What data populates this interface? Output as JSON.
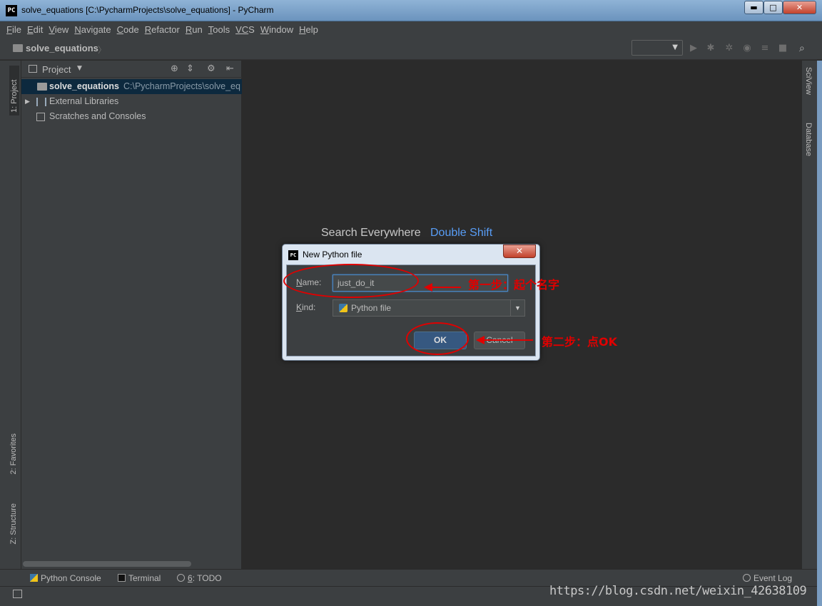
{
  "window": {
    "title": "solve_equations [C:\\PycharmProjects\\solve_equations] - PyCharm",
    "app_icon_text": "PC",
    "minimize": "▬",
    "maximize": "□",
    "close": "✕"
  },
  "menu": [
    {
      "mn": "F",
      "rest": "ile"
    },
    {
      "mn": "E",
      "rest": "dit"
    },
    {
      "mn": "V",
      "rest": "iew"
    },
    {
      "mn": "N",
      "rest": "avigate"
    },
    {
      "mn": "C",
      "rest": "ode"
    },
    {
      "mn": "R",
      "rest": "efactor"
    },
    {
      "mn": "R",
      "rest": "un"
    },
    {
      "mn": "T",
      "rest": "ools"
    },
    {
      "mn": "VC",
      "rest": "S"
    },
    {
      "mn": "W",
      "rest": "indow"
    },
    {
      "mn": "H",
      "rest": "elp"
    }
  ],
  "navbar": {
    "project_name": "solve_equations",
    "separator": "〉"
  },
  "tool_windows": {
    "left_project": "1: Project",
    "left_favorites": "2: Favorites",
    "left_structure": "Z: Structure",
    "right_sciview": "SciView",
    "right_database": "Database"
  },
  "project_panel": {
    "title": "Project",
    "caret": "▼",
    "tree": {
      "root_name": "solve_equations",
      "root_path": "C:\\PycharmProjects\\solve_eq",
      "external_libraries": "External Libraries",
      "scratches": "Scratches and Consoles",
      "expand_arrow": "▶"
    }
  },
  "editor": {
    "hint_text": "Search Everywhere",
    "hint_shortcut": "Double Shift"
  },
  "dialog": {
    "icon_text": "PC",
    "title": "New Python file",
    "close": "✕",
    "name_label_mn": "N",
    "name_label_rest": "ame:",
    "name_value": "just_do_it",
    "kind_label_mn": "K",
    "kind_label_rest": "ind:",
    "kind_value": "Python file",
    "kind_arrow": "▼",
    "ok_label": "OK",
    "cancel_label": "Cancel"
  },
  "annotations": {
    "step1": "第一步：起个名字",
    "step2": "第二步：点OK",
    "color": "#e00000"
  },
  "bottom_tabs": {
    "python_console": "Python Console",
    "terminal": "Terminal",
    "todo_mn": "6",
    "todo_rest": ": TODO",
    "event_log": "Event Log"
  },
  "watermark": "https://blog.csdn.net/weixin_42638109",
  "colors": {
    "background": "#2b2b2b",
    "panel": "#3c3f41",
    "selection": "#0d293e",
    "link_blue": "#589df6",
    "ok_button": "#365880"
  }
}
